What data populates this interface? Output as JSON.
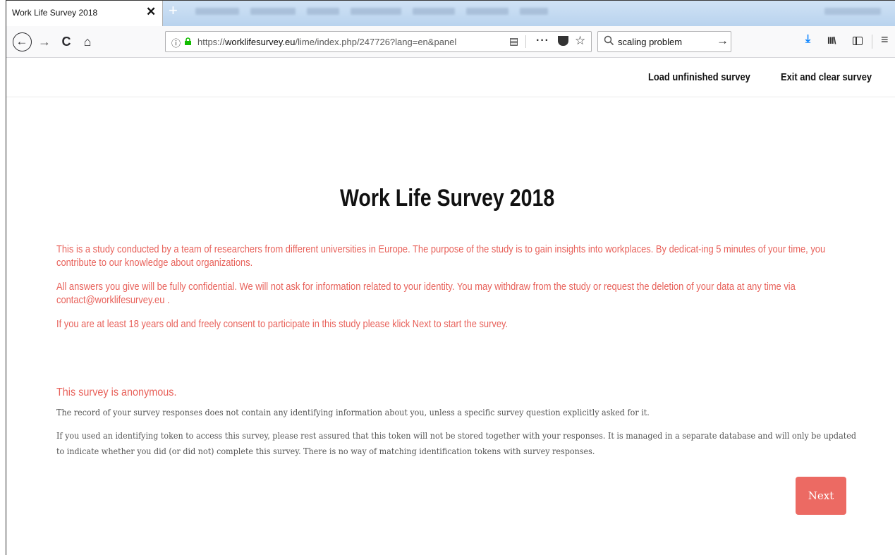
{
  "browser": {
    "tab_title": "Work Life Survey 2018",
    "tab_close": "✕",
    "new_tab": "+",
    "url_prefix": "https://",
    "url_host": "worklifesurvey.eu",
    "url_path": "/lime/index.php/247726?lang=en&panel",
    "search_value": "scaling problem",
    "icons": {
      "back": "←",
      "forward": "→",
      "reload": "C",
      "home": "⌂",
      "info": "ⓘ",
      "reader": "▤",
      "more": "···",
      "star": "☆",
      "search": "🔍",
      "go": "→",
      "download": "⤓",
      "library": "III\\",
      "menu": "≡"
    }
  },
  "header": {
    "load_link": "Load unfinished survey",
    "exit_link": "Exit and clear survey"
  },
  "survey": {
    "title": "Work Life Survey 2018",
    "intro_1": "This is a study conducted by a team of researchers from different universities in Europe. The purpose of the study is to gain insights into workplaces. By dedicat-ing 5 minutes of your time, you contribute to our knowledge about organizations.",
    "intro_2": "All answers you give will be fully confidential. We will not ask for information related to your identity. You may withdraw from the study or request the deletion of your data at any time via contact@worklifesurvey.eu .",
    "intro_3": "If you are at least 18 years old and freely consent to participate in this study please klick Next to start the survey.",
    "anon_heading": "This survey is anonymous.",
    "anon_text_1": "The record of your survey responses does not contain any identifying information about you, unless a specific survey question explicitly asked for it.",
    "anon_text_2": "If you used an identifying token to access this survey, please rest assured that this token will not be stored together with your responses. It is managed in a separate database and will only be updated to indicate whether you did (or did not) complete this survey. There is no way of matching identification tokens with survey responses.",
    "next_label": "Next"
  },
  "colors": {
    "accent_red": "#e8615a",
    "button_red": "#ec6a63",
    "secure_lock": "#12bc00"
  }
}
